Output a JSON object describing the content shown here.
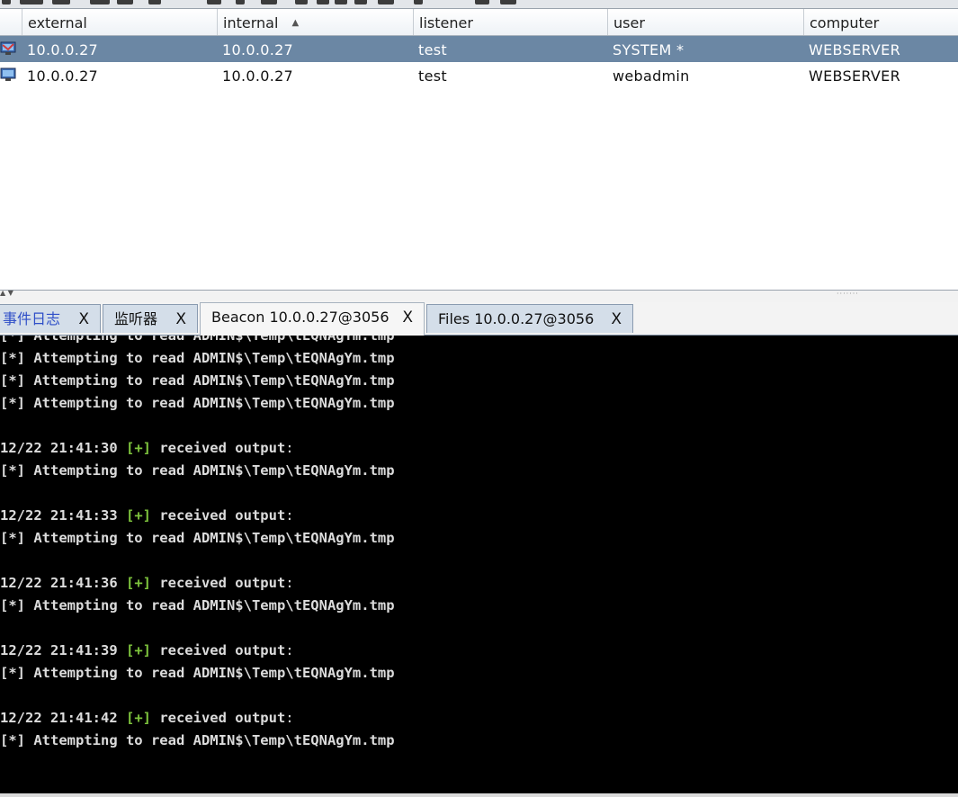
{
  "table": {
    "columns": [
      {
        "label": "external"
      },
      {
        "label": "internal"
      },
      {
        "label": "listener"
      },
      {
        "label": "user"
      },
      {
        "label": "computer"
      }
    ],
    "sorted_column": "internal",
    "rows": [
      {
        "external": "10.0.0.27",
        "internal": "10.0.0.27",
        "listener": "test",
        "user": "SYSTEM *",
        "computer": "WEBSERVER",
        "selected": true,
        "icon": "beacon-elevated-icon"
      },
      {
        "external": "10.0.0.27",
        "internal": "10.0.0.27",
        "listener": "test",
        "user": "webadmin",
        "computer": "WEBSERVER",
        "selected": false,
        "icon": "beacon-icon"
      }
    ]
  },
  "tabs": [
    {
      "label": "事件日志",
      "close": "X",
      "active": false
    },
    {
      "label": "监听器",
      "close": "X",
      "active": false
    },
    {
      "label": "Beacon 10.0.0.27@3056",
      "close": "X",
      "active": true
    },
    {
      "label": "Files 10.0.0.27@3056",
      "close": "X",
      "active": false
    }
  ],
  "console": {
    "lines": [
      {
        "kind": "info",
        "text": "[*] Attempting to read ADMIN$\\Temp\\tEQNAgYm.tmp"
      },
      {
        "kind": "info",
        "text": "[*] Attempting to read ADMIN$\\Temp\\tEQNAgYm.tmp"
      },
      {
        "kind": "info",
        "text": "[*] Attempting to read ADMIN$\\Temp\\tEQNAgYm.tmp"
      },
      {
        "kind": "info",
        "text": "[*] Attempting to read ADMIN$\\Temp\\tEQNAgYm.tmp"
      },
      {
        "kind": "blank"
      },
      {
        "kind": "output",
        "timestamp": "12/22 21:41:30",
        "marker": "[+]",
        "text": "received output",
        "suffix": ":"
      },
      {
        "kind": "info",
        "text": "[*] Attempting to read ADMIN$\\Temp\\tEQNAgYm.tmp"
      },
      {
        "kind": "blank"
      },
      {
        "kind": "output",
        "timestamp": "12/22 21:41:33",
        "marker": "[+]",
        "text": "received output",
        "suffix": ":"
      },
      {
        "kind": "info",
        "text": "[*] Attempting to read ADMIN$\\Temp\\tEQNAgYm.tmp"
      },
      {
        "kind": "blank"
      },
      {
        "kind": "output",
        "timestamp": "12/22 21:41:36",
        "marker": "[+]",
        "text": "received output",
        "suffix": ":"
      },
      {
        "kind": "info",
        "text": "[*] Attempting to read ADMIN$\\Temp\\tEQNAgYm.tmp"
      },
      {
        "kind": "blank"
      },
      {
        "kind": "output",
        "timestamp": "12/22 21:41:39",
        "marker": "[+]",
        "text": "received output",
        "suffix": ":"
      },
      {
        "kind": "info",
        "text": "[*] Attempting to read ADMIN$\\Temp\\tEQNAgYm.tmp"
      },
      {
        "kind": "blank"
      },
      {
        "kind": "output",
        "timestamp": "12/22 21:41:42",
        "marker": "[+]",
        "text": "received output",
        "suffix": ":"
      },
      {
        "kind": "info",
        "text": "[*] Attempting to read ADMIN$\\Temp\\tEQNAgYm.tmp"
      }
    ]
  },
  "colors": {
    "selected_row": "#6b87a4",
    "console_bg": "#000000",
    "console_text": "#dcdcdc",
    "success_marker": "#7ec43d",
    "tab_blue_text": "#2f4fc8"
  }
}
